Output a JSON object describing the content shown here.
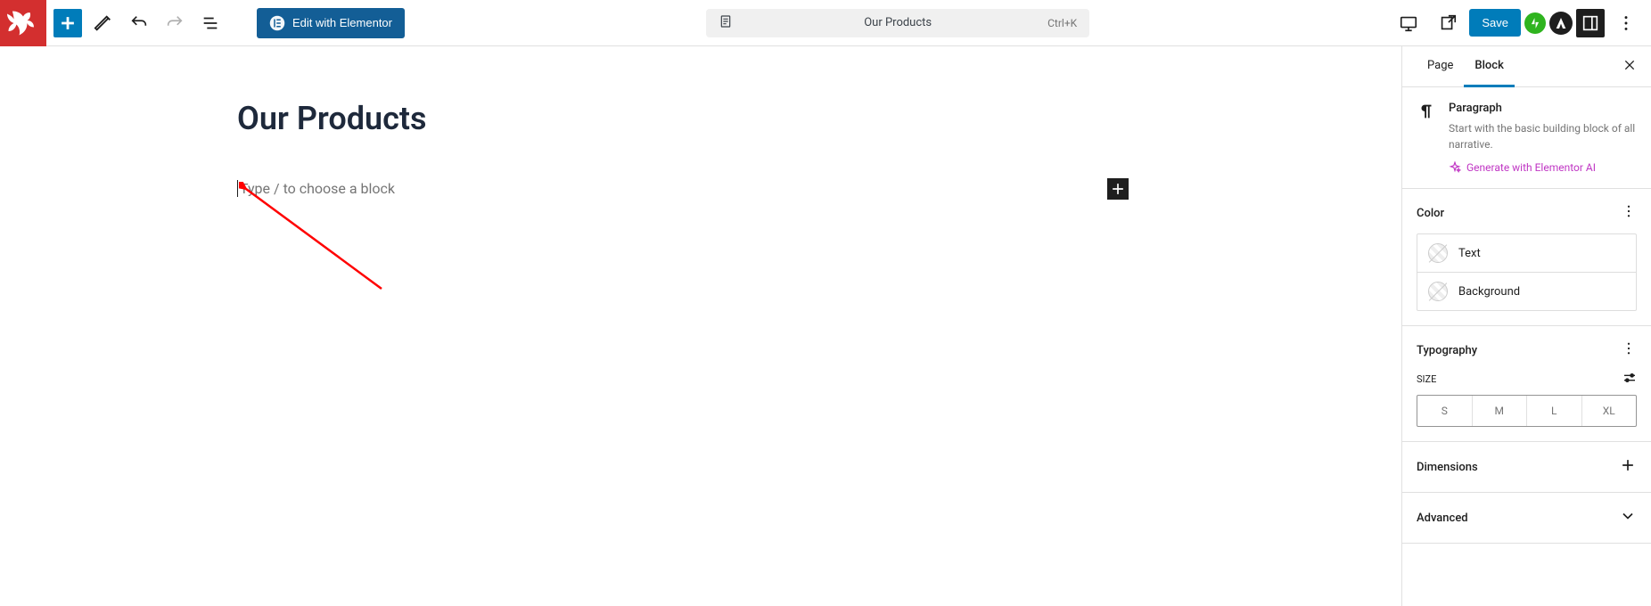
{
  "toolbar": {
    "elementor_label": "Edit with Elementor",
    "document_title": "Our Products",
    "shortcut": "Ctrl+K",
    "save_label": "Save"
  },
  "editor": {
    "page_title": "Our Products",
    "placeholder": "Type / to choose a block"
  },
  "sidebar": {
    "tabs": {
      "page": "Page",
      "block": "Block"
    },
    "block": {
      "name": "Paragraph",
      "description": "Start with the basic building block of all narrative.",
      "ai_link": "Generate with Elementor AI"
    },
    "color": {
      "title": "Color",
      "text_label": "Text",
      "background_label": "Background"
    },
    "typography": {
      "title": "Typography",
      "size_label": "SIZE",
      "sizes": [
        "S",
        "M",
        "L",
        "XL"
      ]
    },
    "dimensions": {
      "title": "Dimensions"
    },
    "advanced": {
      "title": "Advanced"
    }
  }
}
